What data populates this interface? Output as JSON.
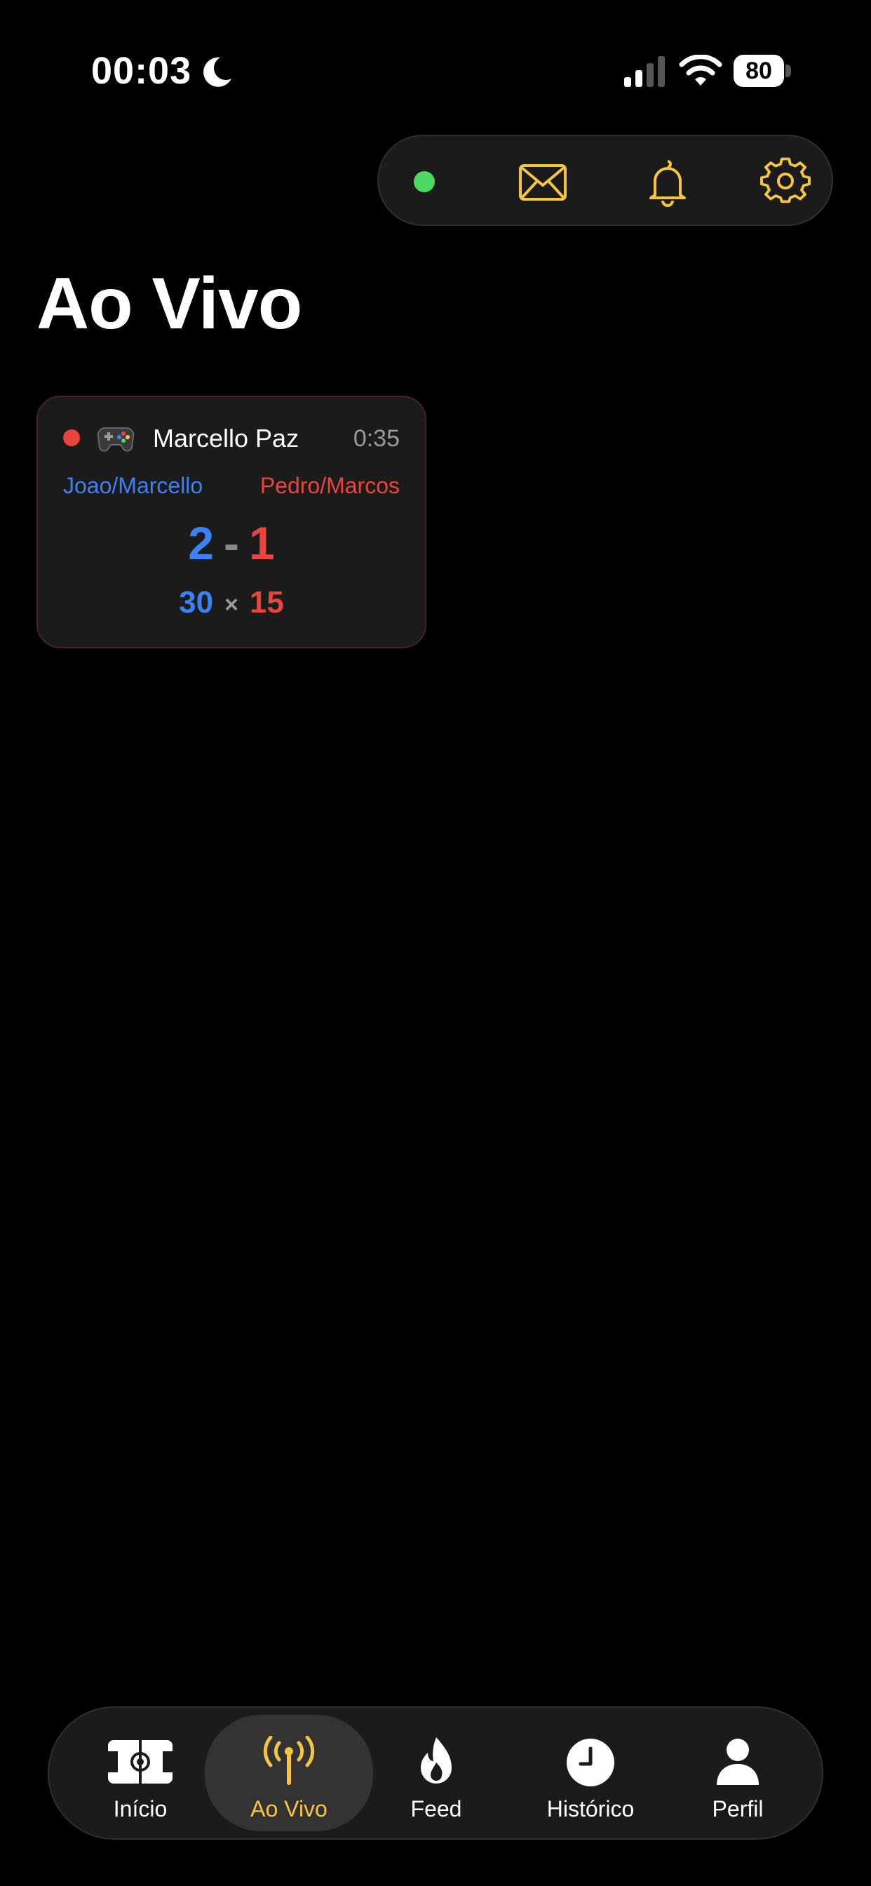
{
  "status_bar": {
    "time": "00:03",
    "battery": "80"
  },
  "page": {
    "title": "Ao Vivo"
  },
  "match": {
    "player": "Marcello Paz",
    "elapsed": "0:35",
    "team_a": "Joao/Marcello",
    "team_b": "Pedro/Marcos",
    "score_a": "2",
    "score_sep": "-",
    "score_b": "1",
    "points_a": "30",
    "points_sep": "×",
    "points_b": "15"
  },
  "tabs": [
    {
      "label": "Início",
      "icon": "court-icon"
    },
    {
      "label": "Ao Vivo",
      "icon": "broadcast-icon",
      "active": true
    },
    {
      "label": "Feed",
      "icon": "flame-icon"
    },
    {
      "label": "Histórico",
      "icon": "clock-icon"
    },
    {
      "label": "Perfil",
      "icon": "person-icon"
    }
  ],
  "colors": {
    "accent": "#f5c542",
    "team_a": "#3b82f6",
    "team_b": "#e8453f",
    "online": "#4cd964"
  }
}
